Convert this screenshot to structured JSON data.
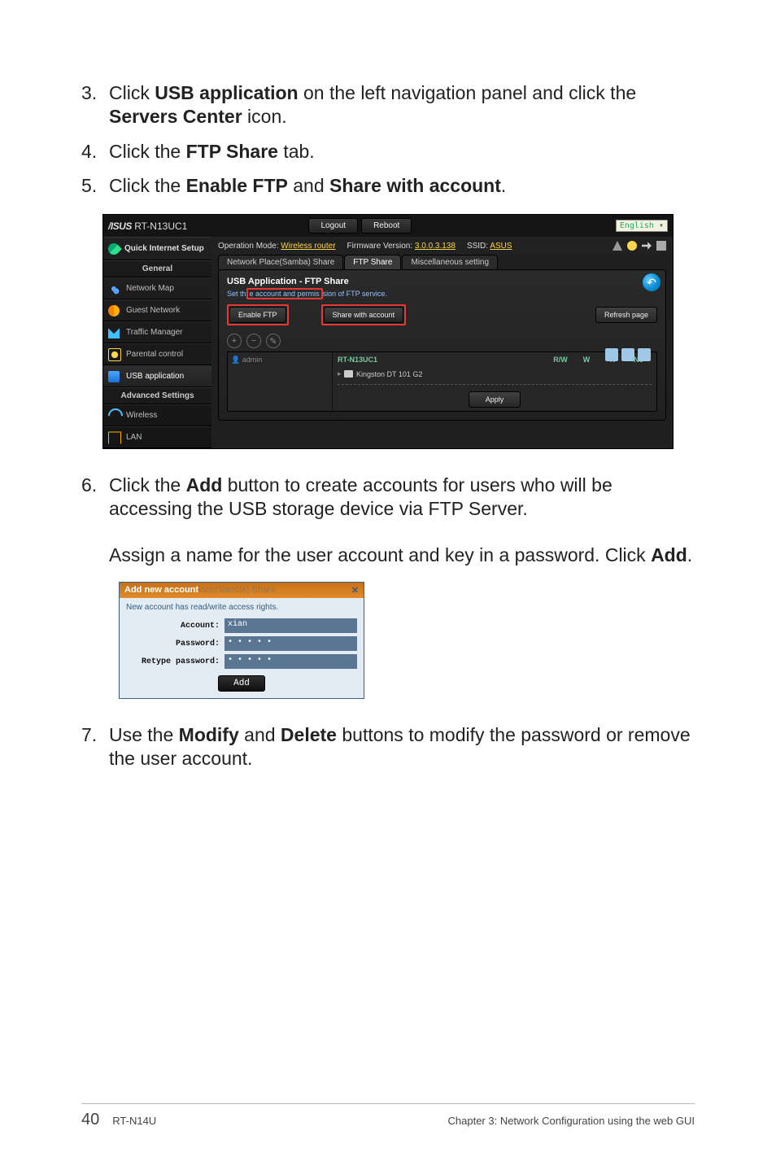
{
  "steps": {
    "s3": {
      "num": "3.",
      "pre": "Click ",
      "b1": "USB application",
      "mid": " on the left navigation panel and click the ",
      "b2": "Servers Center",
      "post": " icon."
    },
    "s4": {
      "num": "4.",
      "pre": "Click the ",
      "b1": "FTP Share",
      "post": " tab."
    },
    "s5": {
      "num": "5.",
      "pre": "Click the ",
      "b1": "Enable FTP",
      "mid": " and ",
      "b2": "Share with account",
      "post": "."
    },
    "s6": {
      "num": "6.",
      "pre": "Click the ",
      "b1": "Add",
      "post": " button to create accounts for users who will be accessing the USB storage device via FTP Server."
    },
    "s6b": {
      "pre": "Assign a name for the user account and key in a password. Click ",
      "b1": "Add",
      "post": "."
    },
    "s7": {
      "num": "7.",
      "pre": "Use the ",
      "b1": "Modify",
      "mid": " and ",
      "b2": "Delete",
      "post": " buttons to modify the password or remove the user account."
    }
  },
  "router": {
    "brand_model": "RT-N13UC1",
    "logout": "Logout",
    "reboot": "Reboot",
    "language": "English",
    "op_mode_label": "Operation Mode:",
    "op_mode_value": "Wireless router",
    "fw_label": "Firmware Version:",
    "fw_value": "3.0.0.3.138",
    "ssid_label": "SSID:",
    "ssid_value": "ASUS",
    "tabs": {
      "samba": "Network Place(Samba) Share",
      "ftp": "FTP Share",
      "misc": "Miscellaneous setting"
    },
    "sidebar": {
      "quick": "Quick Internet Setup",
      "general": "General",
      "items": [
        "Network Map",
        "Guest Network",
        "Traffic Manager",
        "Parental control",
        "USB application"
      ],
      "advanced": "Advanced Settings",
      "adv_items": [
        "Wireless",
        "LAN"
      ]
    },
    "panel": {
      "title": "USB Application - FTP Share",
      "subtitle": "Set the account and permission of FTP service.",
      "enable_ftp": "Enable FTP",
      "share_account": "Share with account",
      "refresh": "Refresh page",
      "admin": "admin",
      "device": "RT-N13UC1",
      "drive": "Kingston DT 101 G2",
      "cols": {
        "rw": "R/W",
        "w": "W",
        "r": "R",
        "no": "No"
      },
      "apply": "Apply"
    }
  },
  "modal": {
    "title": "Add new account",
    "ghost_title": "lace(Samba) Share",
    "note": "New account has read/write access rights.",
    "account_label": "Account:",
    "account_value": "xian",
    "password_label": "Password:",
    "retype_label": "Retype password:",
    "dots": "•  •  •  •  •",
    "add": "Add"
  },
  "footer": {
    "page": "40",
    "model": "RT-N14U",
    "chapter": "Chapter 3: Network Configuration using the web GUI"
  }
}
